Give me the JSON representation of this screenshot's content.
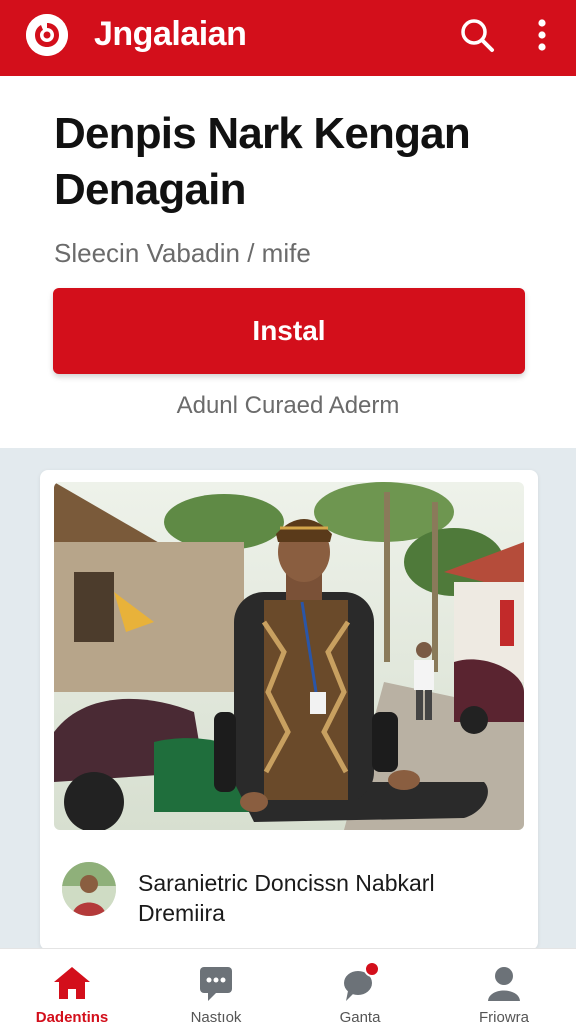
{
  "header": {
    "brand": "Jngalaian",
    "icons": [
      "logo-icon",
      "search-icon",
      "more-vertical-icon"
    ],
    "color": "#d30f1b"
  },
  "hero": {
    "title": "Denpis Nark Kengan Denagain",
    "subtitle": "Sleecin Vabadin / mife",
    "install_label": "Instal",
    "note": "Adunl Curaed Aderm"
  },
  "feed": {
    "caption": "Saranietric Doncissn Nabkarl Dremiira"
  },
  "bottom_nav": {
    "items": [
      {
        "label": "Dadentins",
        "icon": "home-icon",
        "active": true
      },
      {
        "label": "Nastıok",
        "icon": "chat-icon",
        "active": false
      },
      {
        "label": "Ganta",
        "icon": "notification-icon",
        "active": false
      },
      {
        "label": "Friowra",
        "icon": "profile-icon",
        "active": false
      }
    ]
  }
}
